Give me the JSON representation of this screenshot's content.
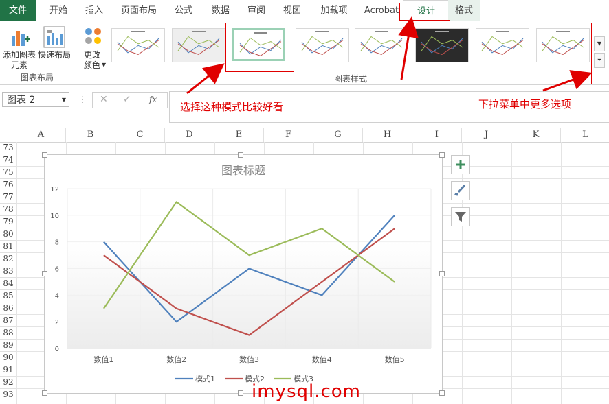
{
  "tabs": [
    "文件",
    "开始",
    "插入",
    "页面布局",
    "公式",
    "数据",
    "审阅",
    "视图",
    "加载项",
    "Acrobat",
    "设计",
    "格式"
  ],
  "ribbon": {
    "add_element": [
      "添加图表",
      "元素"
    ],
    "quick_layout": "快速布局",
    "change_color": [
      "更改",
      "颜色"
    ],
    "group_layout": "图表布局",
    "group_styles": "图表样式"
  },
  "formula_bar": {
    "name_box": "图表 2",
    "fx": "fx"
  },
  "annotations": {
    "pick_style": "选择这种模式比较好看",
    "more_options": "下拉菜单中更多选项",
    "watermark": "imysql.com"
  },
  "columns": [
    "A",
    "B",
    "C",
    "D",
    "E",
    "F",
    "G",
    "H",
    "I",
    "J",
    "K",
    "L"
  ],
  "rows": [
    "73",
    "74",
    "75",
    "76",
    "77",
    "78",
    "79",
    "80",
    "81",
    "82",
    "83",
    "84",
    "85",
    "86",
    "87",
    "88",
    "89",
    "90",
    "91",
    "92",
    "93"
  ],
  "chart_data": {
    "type": "line",
    "title": "图表标题",
    "categories": [
      "数值1",
      "数值2",
      "数值3",
      "数值4",
      "数值5"
    ],
    "series": [
      {
        "name": "模式1",
        "color": "#4f81bd",
        "values": [
          8,
          2,
          6,
          4,
          10
        ]
      },
      {
        "name": "模式2",
        "color": "#c0504d",
        "values": [
          7,
          3,
          1,
          5,
          9
        ]
      },
      {
        "name": "模式3",
        "color": "#9bbb59",
        "values": [
          3,
          11,
          7,
          9,
          5
        ]
      }
    ],
    "ylim": [
      0,
      12
    ],
    "yticks": [
      "0",
      "2",
      "4",
      "6",
      "8",
      "10",
      "12"
    ],
    "legend": "bottom"
  }
}
